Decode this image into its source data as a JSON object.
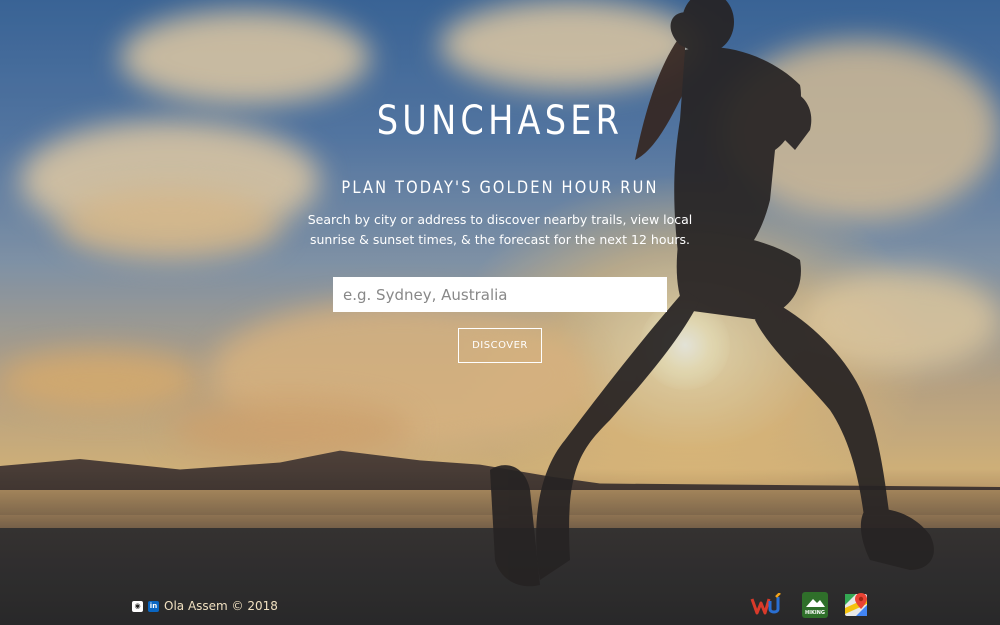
{
  "app": {
    "title": "SUNCHASER",
    "subtitle": "PLAN TODAY'S GOLDEN HOUR RUN",
    "description_line1": "Search by city or address to discover nearby trails, view local",
    "description_line2": "sunrise & sunset times, & the forecast for the next 12 hours."
  },
  "search": {
    "placeholder": "e.g. Sydney, Australia",
    "value": ""
  },
  "discover_button": {
    "label": "DISCOVER"
  },
  "footer": {
    "credit": "Ola Assem © 2018",
    "social_icons": [
      "github-icon",
      "linkedin-icon"
    ],
    "github_glyph": "◉",
    "linkedin_glyph": "in",
    "partner_icons": [
      "weather-underground-icon",
      "hiking-project-icon",
      "google-maps-icon"
    ],
    "hiking_label": "HIKING"
  },
  "colors": {
    "text": "#ffffff",
    "footer_text": "#f0e0c0",
    "linkedin_blue": "#0a66c2",
    "hiking_green": "#2f6f2a"
  }
}
